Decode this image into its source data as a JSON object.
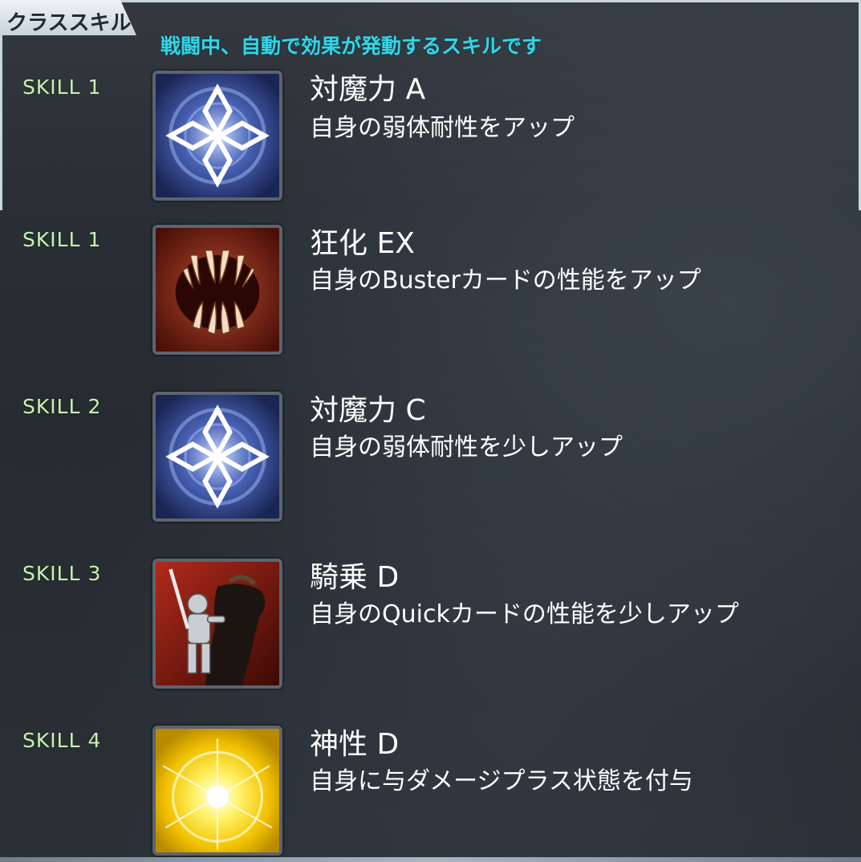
{
  "panel": {
    "tab_label": "クラススキル",
    "subtitle": "戦闘中、自動で効果が発動するスキルです"
  },
  "skills": [
    {
      "slot": "SKILL 1",
      "name": "対魔力 A",
      "desc": "自身の弱体耐性をアップ",
      "icon": "magic-resistance-icon"
    },
    {
      "slot": "SKILL 1",
      "name": "狂化 EX",
      "desc": "自身のBusterカードの性能をアップ",
      "icon": "madness-fangs-icon"
    },
    {
      "slot": "SKILL 2",
      "name": "対魔力 C",
      "desc": "自身の弱体耐性を少しアップ",
      "icon": "magic-resistance-icon"
    },
    {
      "slot": "SKILL 3",
      "name": "騎乗 D",
      "desc": "自身のQuickカードの性能を少しアップ",
      "icon": "riding-knight-icon"
    },
    {
      "slot": "SKILL 4",
      "name": "神性 D",
      "desc": "自身に与ダメージプラス状態を付与",
      "icon": "divinity-light-icon"
    }
  ]
}
